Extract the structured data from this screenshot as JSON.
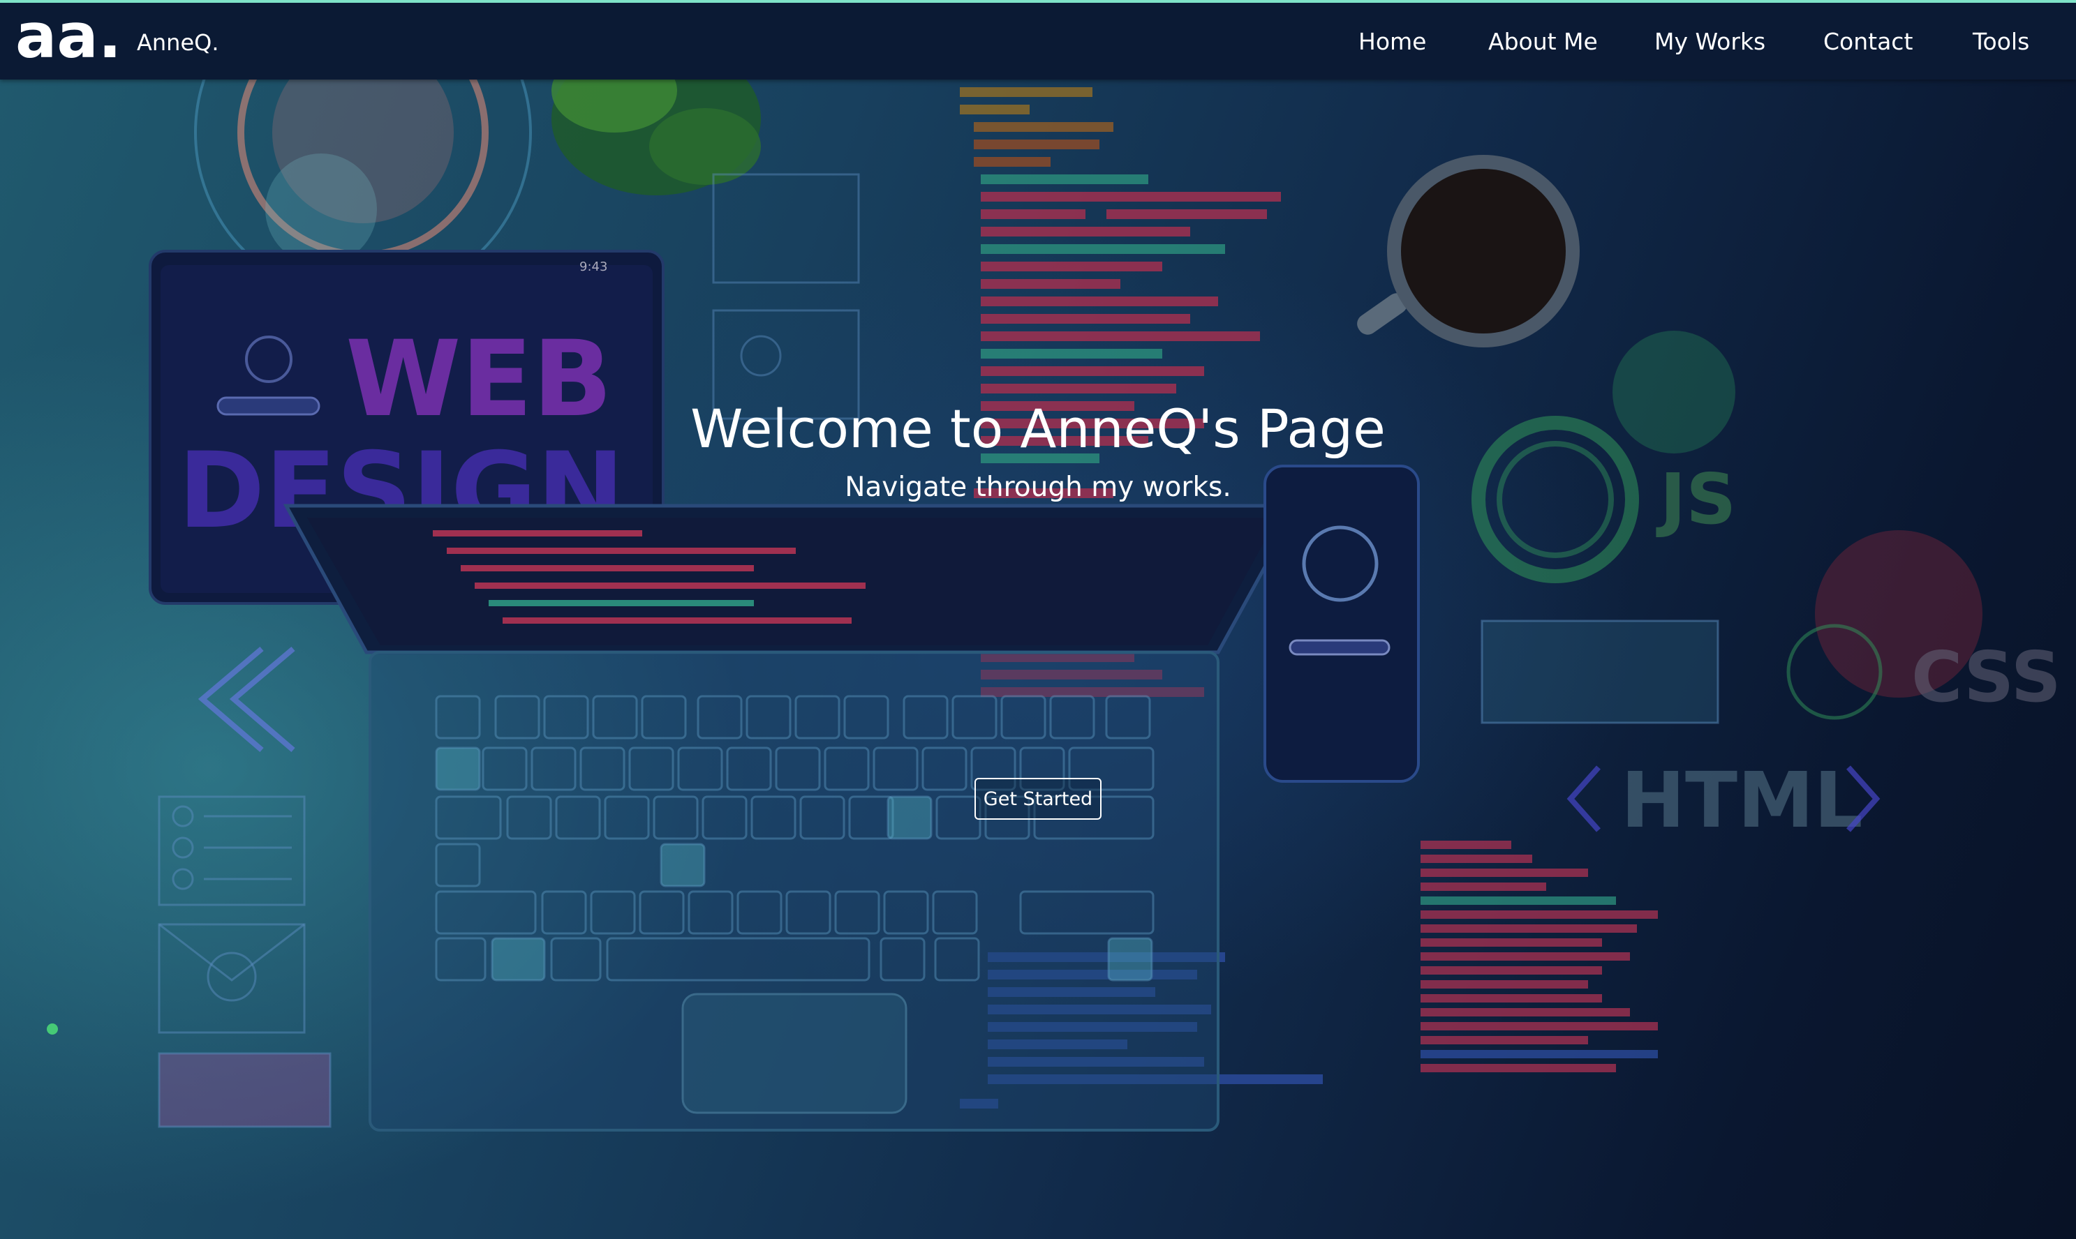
{
  "brand": {
    "logo_text": "aa.",
    "name": "AnneQ."
  },
  "nav": {
    "home": "Home",
    "about": "About Me",
    "works": "My Works",
    "contact": "Contact",
    "tools": "Tools"
  },
  "hero": {
    "title": "Welcome to AnneQ's Page",
    "subtitle": "Navigate through my works.",
    "cta_label": "Get Started"
  },
  "background": {
    "word_web": "WEB",
    "word_design": "DESIGN",
    "tag_js": "JS",
    "tag_css": "CSS",
    "tag_html": "HTML",
    "phone_time": "9:43"
  },
  "icons": [
    "coffee-cup-icon",
    "plant-icon",
    "checklist-icon",
    "video-envelope-icon",
    "chevron-left-icon",
    "chevron-right-icon",
    "users-icon"
  ],
  "colors": {
    "nav_bg": "#0b1a34",
    "accent_top_border": "#7fe3c8",
    "text": "#ffffff"
  }
}
